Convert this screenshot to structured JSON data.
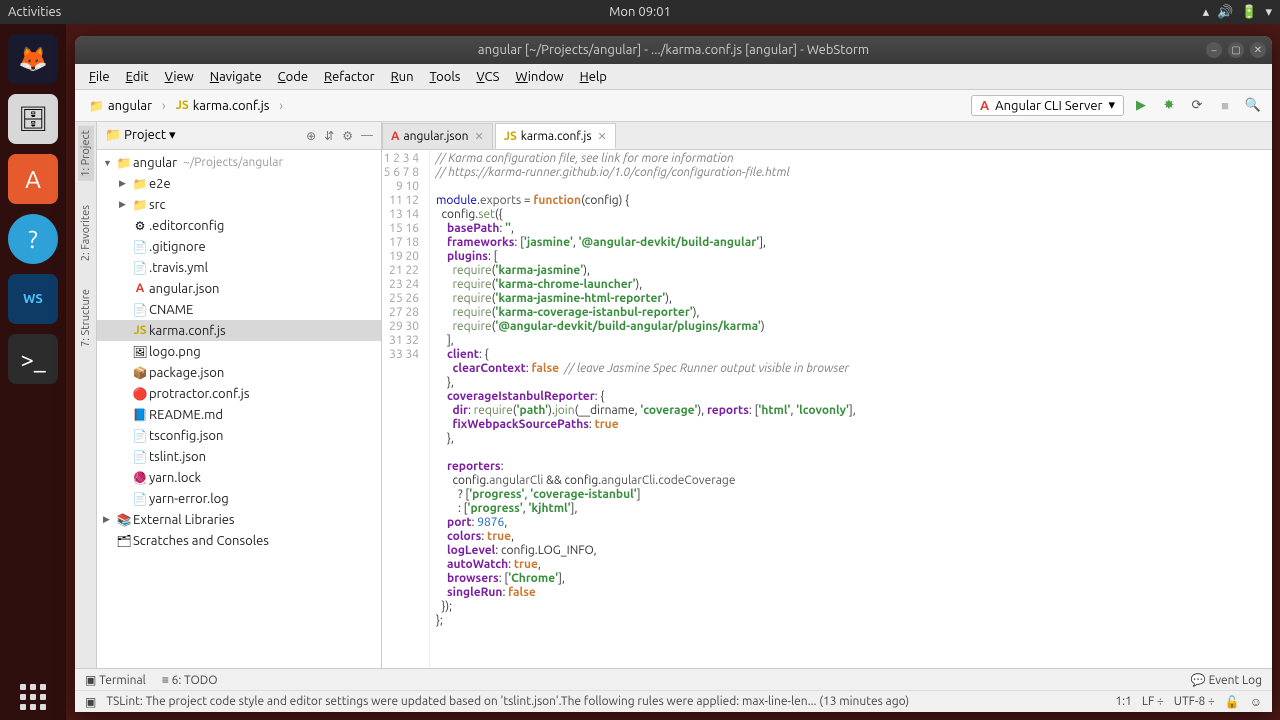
{
  "topbar": {
    "activities": "Activities",
    "clock": "Mon 09:01"
  },
  "window": {
    "title": "angular [~/Projects/angular] - .../karma.conf.js [angular] - WebStorm"
  },
  "menu": [
    "File",
    "Edit",
    "View",
    "Navigate",
    "Code",
    "Refactor",
    "Run",
    "Tools",
    "VCS",
    "Window",
    "Help"
  ],
  "breadcrumb": {
    "root": "angular",
    "file": "karma.conf.js"
  },
  "runconfig": {
    "label": "Angular CLI Server"
  },
  "projectpanel": {
    "title": "Project"
  },
  "tree": {
    "root": "angular",
    "root_hint": "~/Projects/angular",
    "dirs": [
      "e2e",
      "src"
    ],
    "files": [
      ".editorconfig",
      ".gitignore",
      ".travis.yml",
      "angular.json",
      "CNAME",
      "karma.conf.js",
      "logo.png",
      "package.json",
      "protractor.conf.js",
      "README.md",
      "tsconfig.json",
      "tslint.json",
      "yarn.lock",
      "yarn-error.log"
    ],
    "extlib": "External Libraries",
    "scratch": "Scratches and Consoles",
    "selected": "karma.conf.js"
  },
  "tabs": [
    {
      "label": "angular.json",
      "icon": "ang"
    },
    {
      "label": "karma.conf.js",
      "icon": "js",
      "active": true
    }
  ],
  "code_lines": 34,
  "bottombar": {
    "terminal": "Terminal",
    "todo": "6: TODO",
    "eventlog": "Event Log"
  },
  "statusbar": {
    "msg": "TSLint: The project code style and editor settings were updated based on 'tslint.json'.The following rules were applied: max-line-len... (13 minutes ago)",
    "pos": "1:1",
    "sep": "LF",
    "enc": "UTF-8"
  }
}
